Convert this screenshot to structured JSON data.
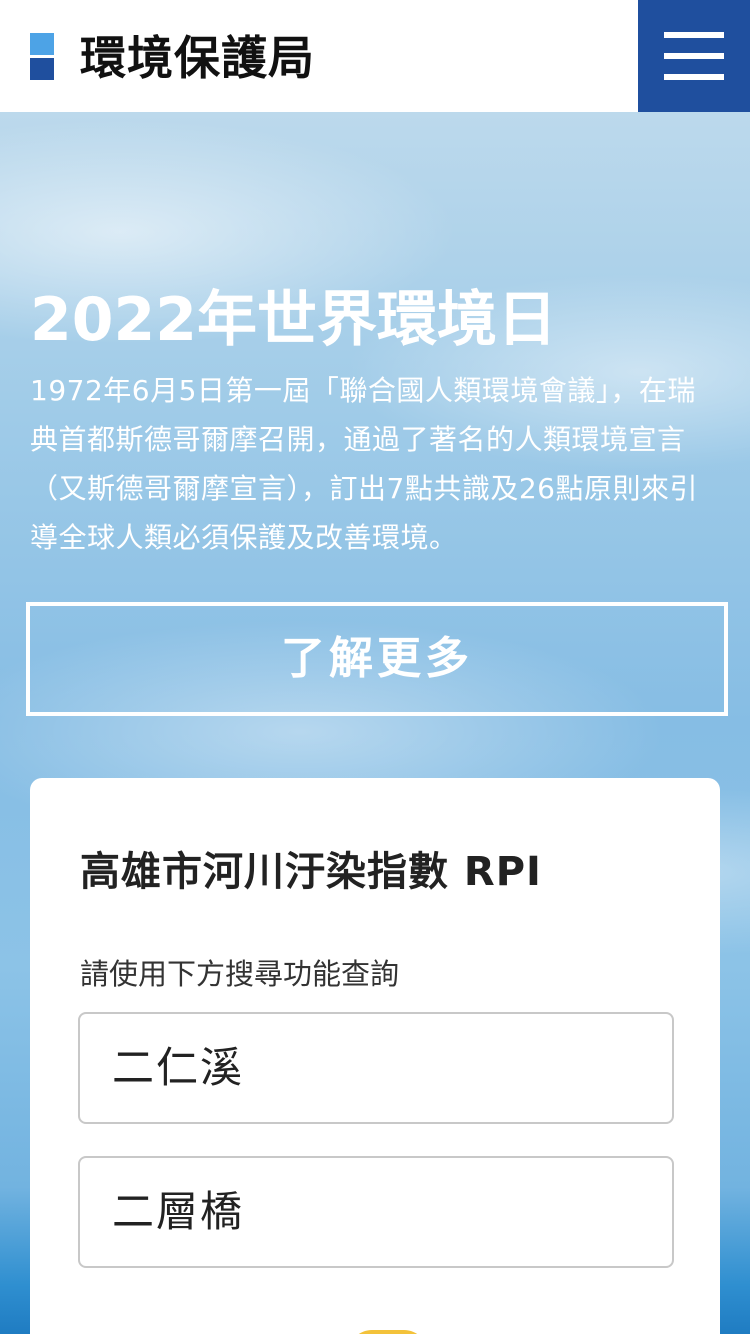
{
  "header": {
    "brand": "環境保護局",
    "menu_icon": "hamburger-menu-icon",
    "colors": {
      "accent": "#1f4f9e",
      "logo_light": "#4da3e6"
    }
  },
  "hero": {
    "title": "2022年世界環境日",
    "description": "1972年6月5日第一屆「聯合國人類環境會議」，在瑞典首都斯德哥爾摩召開，通過了著名的人類環境宣言（又斯德哥爾摩宣言），訂出7點共識及26點原則來引導全球人類必須保護及改善環境。",
    "more_button_label": "了解更多"
  },
  "rpi_card": {
    "title": "高雄市河川汙染指數 RPI",
    "hint": "請使用下方搜尋功能查詢",
    "select_river": "二仁溪",
    "select_station": "二層橋"
  }
}
